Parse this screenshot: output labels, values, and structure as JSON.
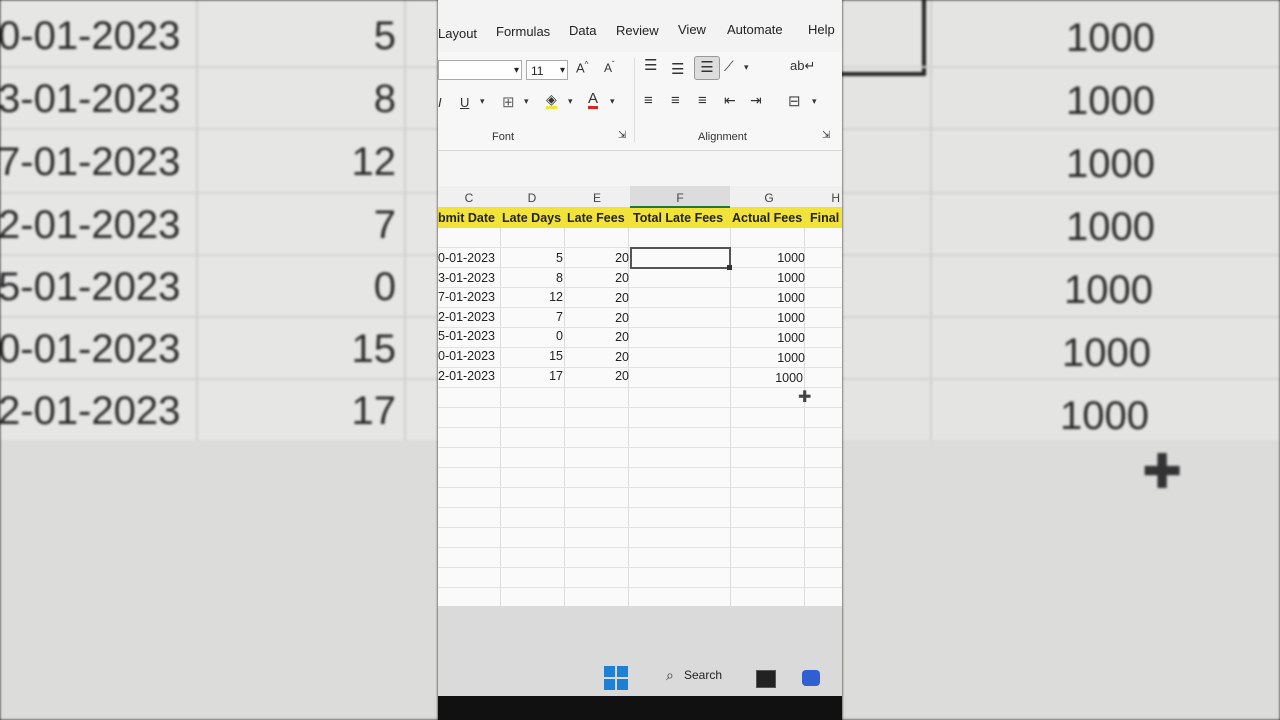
{
  "ribbon": {
    "tabs": [
      "Layout",
      "Formulas",
      "Data",
      "Review",
      "View",
      "Automate",
      "Help"
    ],
    "font_size": "11",
    "groups": [
      "Font",
      "Alignment"
    ]
  },
  "sheet": {
    "columns": [
      "C",
      "D",
      "E",
      "F",
      "G",
      "H"
    ],
    "selected_column": "F",
    "headers": [
      "bmit Date",
      "Late Days",
      "Late Fees",
      "Total Late Fees",
      "Actual Fees",
      "Final"
    ],
    "rows": [
      {
        "date": "0-01-2023",
        "late_days": "5",
        "late_fees": "20",
        "total": "",
        "actual": "1000"
      },
      {
        "date": "3-01-2023",
        "late_days": "8",
        "late_fees": "20",
        "total": "",
        "actual": "1000"
      },
      {
        "date": "7-01-2023",
        "late_days": "12",
        "late_fees": "20",
        "total": "",
        "actual": "1000"
      },
      {
        "date": "2-01-2023",
        "late_days": "7",
        "late_fees": "20",
        "total": "",
        "actual": "1000"
      },
      {
        "date": "5-01-2023",
        "late_days": "0",
        "late_fees": "20",
        "total": "",
        "actual": "1000"
      },
      {
        "date": "0-01-2023",
        "late_days": "15",
        "late_fees": "20",
        "total": "",
        "actual": "1000"
      },
      {
        "date": "2-01-2023",
        "late_days": "17",
        "late_fees": "20",
        "total": "",
        "actual": "1000"
      }
    ]
  },
  "left_zoom": {
    "dates": [
      "0-01-2023",
      "3-01-2023",
      "7-01-2023",
      "2-01-2023",
      "5-01-2023",
      "0-01-2023",
      "2-01-2023"
    ],
    "days": [
      "5",
      "8",
      "12",
      "7",
      "0",
      "15",
      "17"
    ]
  },
  "right_zoom": {
    "values": [
      "1000",
      "1000",
      "1000",
      "1000",
      "1000",
      "1000",
      "1000"
    ]
  },
  "taskbar": {
    "search_label": "Search"
  },
  "colors": {
    "header_fill": "#f2e33a",
    "excel_green": "#1d7a3a",
    "windows_blue": "#1e7fd6"
  }
}
